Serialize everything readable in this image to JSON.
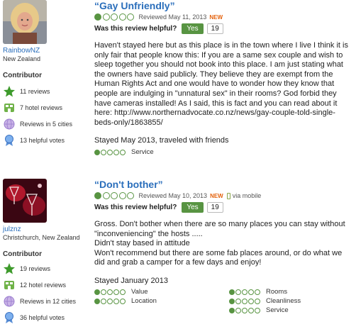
{
  "reviews": [
    {
      "user": {
        "name": "RainbowNZ",
        "location": "New Zealand",
        "level": "Contributor"
      },
      "stats": [
        "11 reviews",
        "7 hotel reviews",
        "Reviews in 5 cities",
        "13 helpful votes"
      ],
      "title": "“Gay Unfriendly”",
      "rating": 1,
      "reviewed": "Reviewed May 11, 2013",
      "new": "NEW",
      "helpful_label": "Was this review helpful?",
      "yes_label": "Yes",
      "helpful_count": "19",
      "body": "Haven't stayed here but as this place is in the town where I live I think it is only fair that people know this: If you are a same sex couple and wish to sleep together you should not book into this place. I am just stating what the owners have said publicly. They believe they are exempt from the Human Rights Act and one would have to wonder how they know that people are indulging in \"unnatural sex\" in their rooms? God forbid they have cameras installed! As I said, this is fact and you can read about it here: http://www.northernadvocate.co.nz/news/gay-couple-told-single-beds-only/1863855/",
      "stayed": "Stayed May 2013, traveled with friends",
      "subratings": [
        {
          "label": "Service",
          "rating": 1
        }
      ]
    },
    {
      "user": {
        "name": "julznz",
        "location": "Christchurch, New Zealand",
        "level": "Contributor"
      },
      "stats": [
        "19 reviews",
        "12 hotel reviews",
        "Reviews in 12 cities",
        "36 helpful votes"
      ],
      "title": "“Don't bother”",
      "rating": 1,
      "reviewed": "Reviewed May 10, 2013",
      "new": "NEW",
      "mobile": "via mobile",
      "helpful_label": "Was this review helpful?",
      "yes_label": "Yes",
      "helpful_count": "19",
      "body_lines": [
        "Gross. Don't bother when there are so many places you can stay without \"inconveniencing\" the hosts .....",
        "Didn't stay based in attitude",
        "Won't recommend but there are some fab places around, or do what we did and grab a camper for a few days and enjoy!"
      ],
      "stayed": "Stayed January 2013",
      "subratings": [
        {
          "label": "Value",
          "rating": 1
        },
        {
          "label": "Rooms",
          "rating": 1
        },
        {
          "label": "Location",
          "rating": 1
        },
        {
          "label": "Cleanliness",
          "rating": 1
        },
        {
          "label": "Service",
          "rating": 1
        }
      ]
    }
  ],
  "icons": [
    "review-star-icon",
    "hotel-review-icon",
    "cities-globe-icon",
    "helpful-vote-ribbon-icon"
  ],
  "colors": {
    "link": "#2a6ebb",
    "bubble": "#589442",
    "new": "#e4620d"
  }
}
